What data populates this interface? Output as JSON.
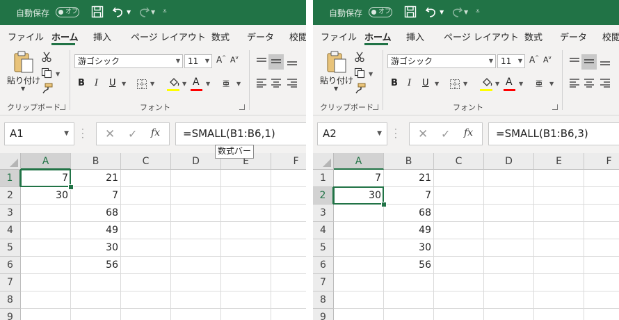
{
  "ribbon": {
    "autosave_label": "自動保存",
    "autosave_state": "オフ",
    "tabs": [
      "ファイル",
      "ホーム",
      "挿入",
      "ページ レイアウト",
      "数式",
      "データ",
      "校閲"
    ],
    "active_tab": "ホーム",
    "clipboard": {
      "paste_label": "貼り付け",
      "group_label": "クリップボード"
    },
    "font": {
      "name": "游ゴシック",
      "size": "11",
      "group_label": "フォント",
      "bold": "B",
      "italic": "I",
      "underline": "U",
      "phonetic": "亜"
    },
    "colors": {
      "accent": "#217346",
      "highlight": "#ffff00",
      "font_color": "#ff0000"
    }
  },
  "panels": [
    {
      "name_box": "A1",
      "formula": "=SMALL(B1:B6,1)",
      "tooltip": "数式バー",
      "columns": [
        "A",
        "B",
        "C",
        "D",
        "E",
        "F"
      ],
      "rows": [
        "1",
        "2",
        "3",
        "4",
        "5",
        "6",
        "7",
        "8",
        "9"
      ],
      "cells": {
        "A1": "7",
        "A2": "30",
        "B1": "21",
        "B2": "7",
        "B3": "68",
        "B4": "49",
        "B5": "30",
        "B6": "56"
      },
      "active_cell": "A1"
    },
    {
      "name_box": "A2",
      "formula": "=SMALL(B1:B6,3)",
      "columns": [
        "A",
        "B",
        "C",
        "D",
        "E",
        "F"
      ],
      "rows": [
        "1",
        "2",
        "3",
        "4",
        "5",
        "6",
        "7",
        "8",
        "9"
      ],
      "cells": {
        "A1": "7",
        "A2": "30",
        "B1": "21",
        "B2": "7",
        "B3": "68",
        "B4": "49",
        "B5": "30",
        "B6": "56"
      },
      "active_cell": "A2"
    }
  ]
}
